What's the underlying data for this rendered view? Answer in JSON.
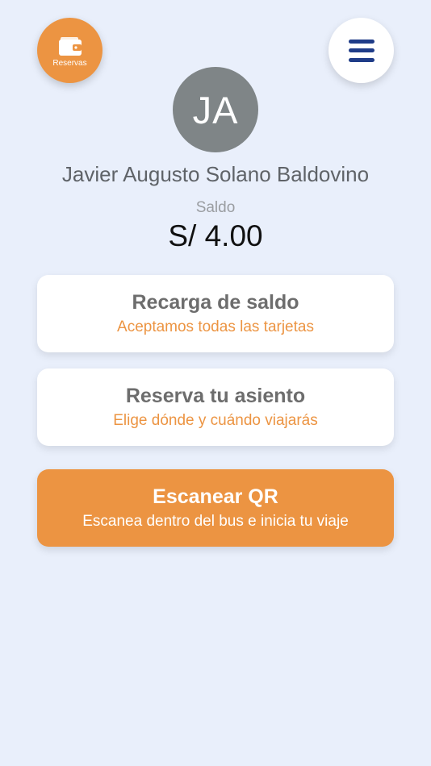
{
  "header": {
    "reservas_label": "Reservas",
    "reservas_icon": "wallet-icon",
    "menu_icon": "hamburger-menu-icon"
  },
  "profile": {
    "avatar_initials": "JA",
    "name": "Javier Augusto Solano Baldovino",
    "balance_label": "Saldo",
    "balance_value": "S/ 4.00"
  },
  "actions": [
    {
      "title": "Recarga de saldo",
      "subtitle": "Aceptamos todas las tarjetas"
    },
    {
      "title": "Reserva tu asiento",
      "subtitle": "Elige dónde y cuándo viajarás"
    }
  ],
  "scan": {
    "title": "Escanear QR",
    "subtitle": "Escanea dentro del bus e inicia tu viaje"
  },
  "colors": {
    "background": "#e9effb",
    "accent_orange": "#ec9442",
    "menu_navy": "#1f3c88",
    "avatar_gray": "#7f8587",
    "card_white": "#ffffff"
  }
}
